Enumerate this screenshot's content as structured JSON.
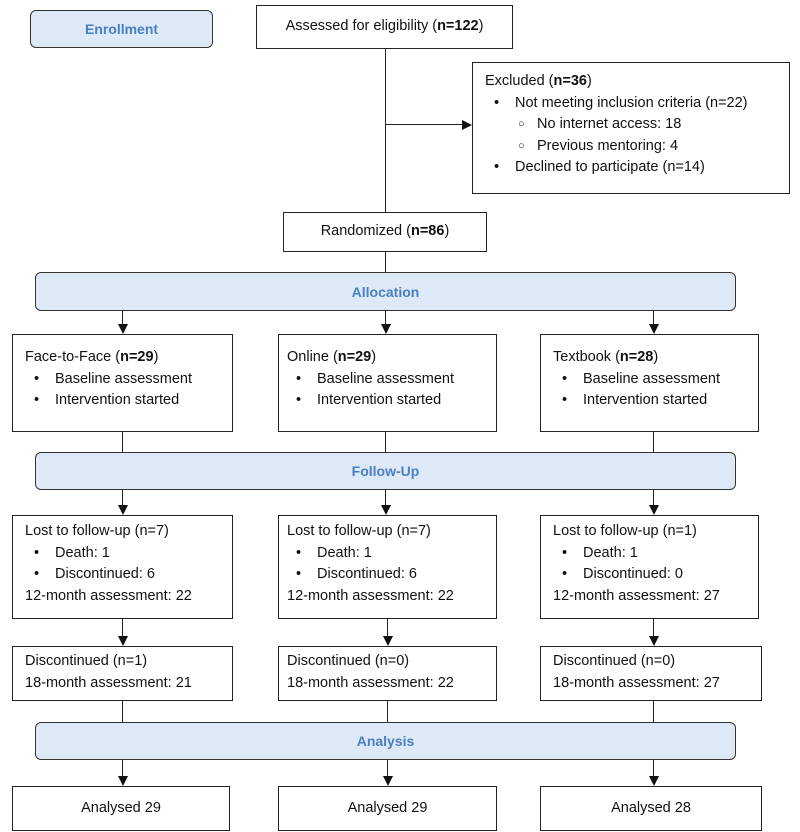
{
  "colors": {
    "band_fill": "#dde9f6",
    "band_text": "#4a7fc1",
    "line": "#222222"
  },
  "stages": {
    "enrollment": "Enrollment",
    "allocation": "Allocation",
    "follow_up": "Follow-Up",
    "analysis": "Analysis"
  },
  "assessed": {
    "label": "Assessed for eligibility (",
    "n": "n=122",
    "close": ")"
  },
  "excluded": {
    "label": "Excluded (",
    "n": "n=36",
    "close": ")",
    "items": [
      {
        "text": "Not meeting inclusion criteria (n=22)",
        "subitems": [
          "No internet access: 18",
          "Previous mentoring: 4"
        ]
      },
      {
        "text": "Declined to participate (n=14)"
      }
    ]
  },
  "randomized": {
    "label": "Randomized (",
    "n": "n=86",
    "close": ")"
  },
  "groups": [
    {
      "name": "Face-to-Face (",
      "n": "n=29",
      "close": ")",
      "allocation_items": [
        "Baseline assessment",
        "Intervention started"
      ],
      "lost": "Lost to follow-up (n=7)",
      "lost_items": [
        "Death: 1",
        "Discontinued: 6"
      ],
      "assessment_12": "12-month assessment: 22",
      "discontinued": "Discontinued (n=1)",
      "assessment_18": "18-month assessment: 21",
      "analysed": "Analysed 29"
    },
    {
      "name": "Online (",
      "n": "n=29",
      "close": ")",
      "allocation_items": [
        "Baseline assessment",
        "Intervention started"
      ],
      "lost": "Lost to follow-up (n=7)",
      "lost_items": [
        "Death: 1",
        "Discontinued: 6"
      ],
      "assessment_12": "12-month assessment: 22",
      "discontinued": "Discontinued (n=0)",
      "assessment_18": "18-month assessment: 22",
      "analysed": "Analysed 29"
    },
    {
      "name": "Textbook (",
      "n": "n=28",
      "close": ")",
      "allocation_items": [
        "Baseline assessment",
        "Intervention started"
      ],
      "lost": "Lost to follow-up (n=1)",
      "lost_items": [
        "Death: 1",
        "Discontinued: 0"
      ],
      "assessment_12": "12-month assessment: 27",
      "discontinued": "Discontinued (n=0)",
      "assessment_18": "18-month assessment: 27",
      "analysed": "Analysed 28"
    }
  ]
}
